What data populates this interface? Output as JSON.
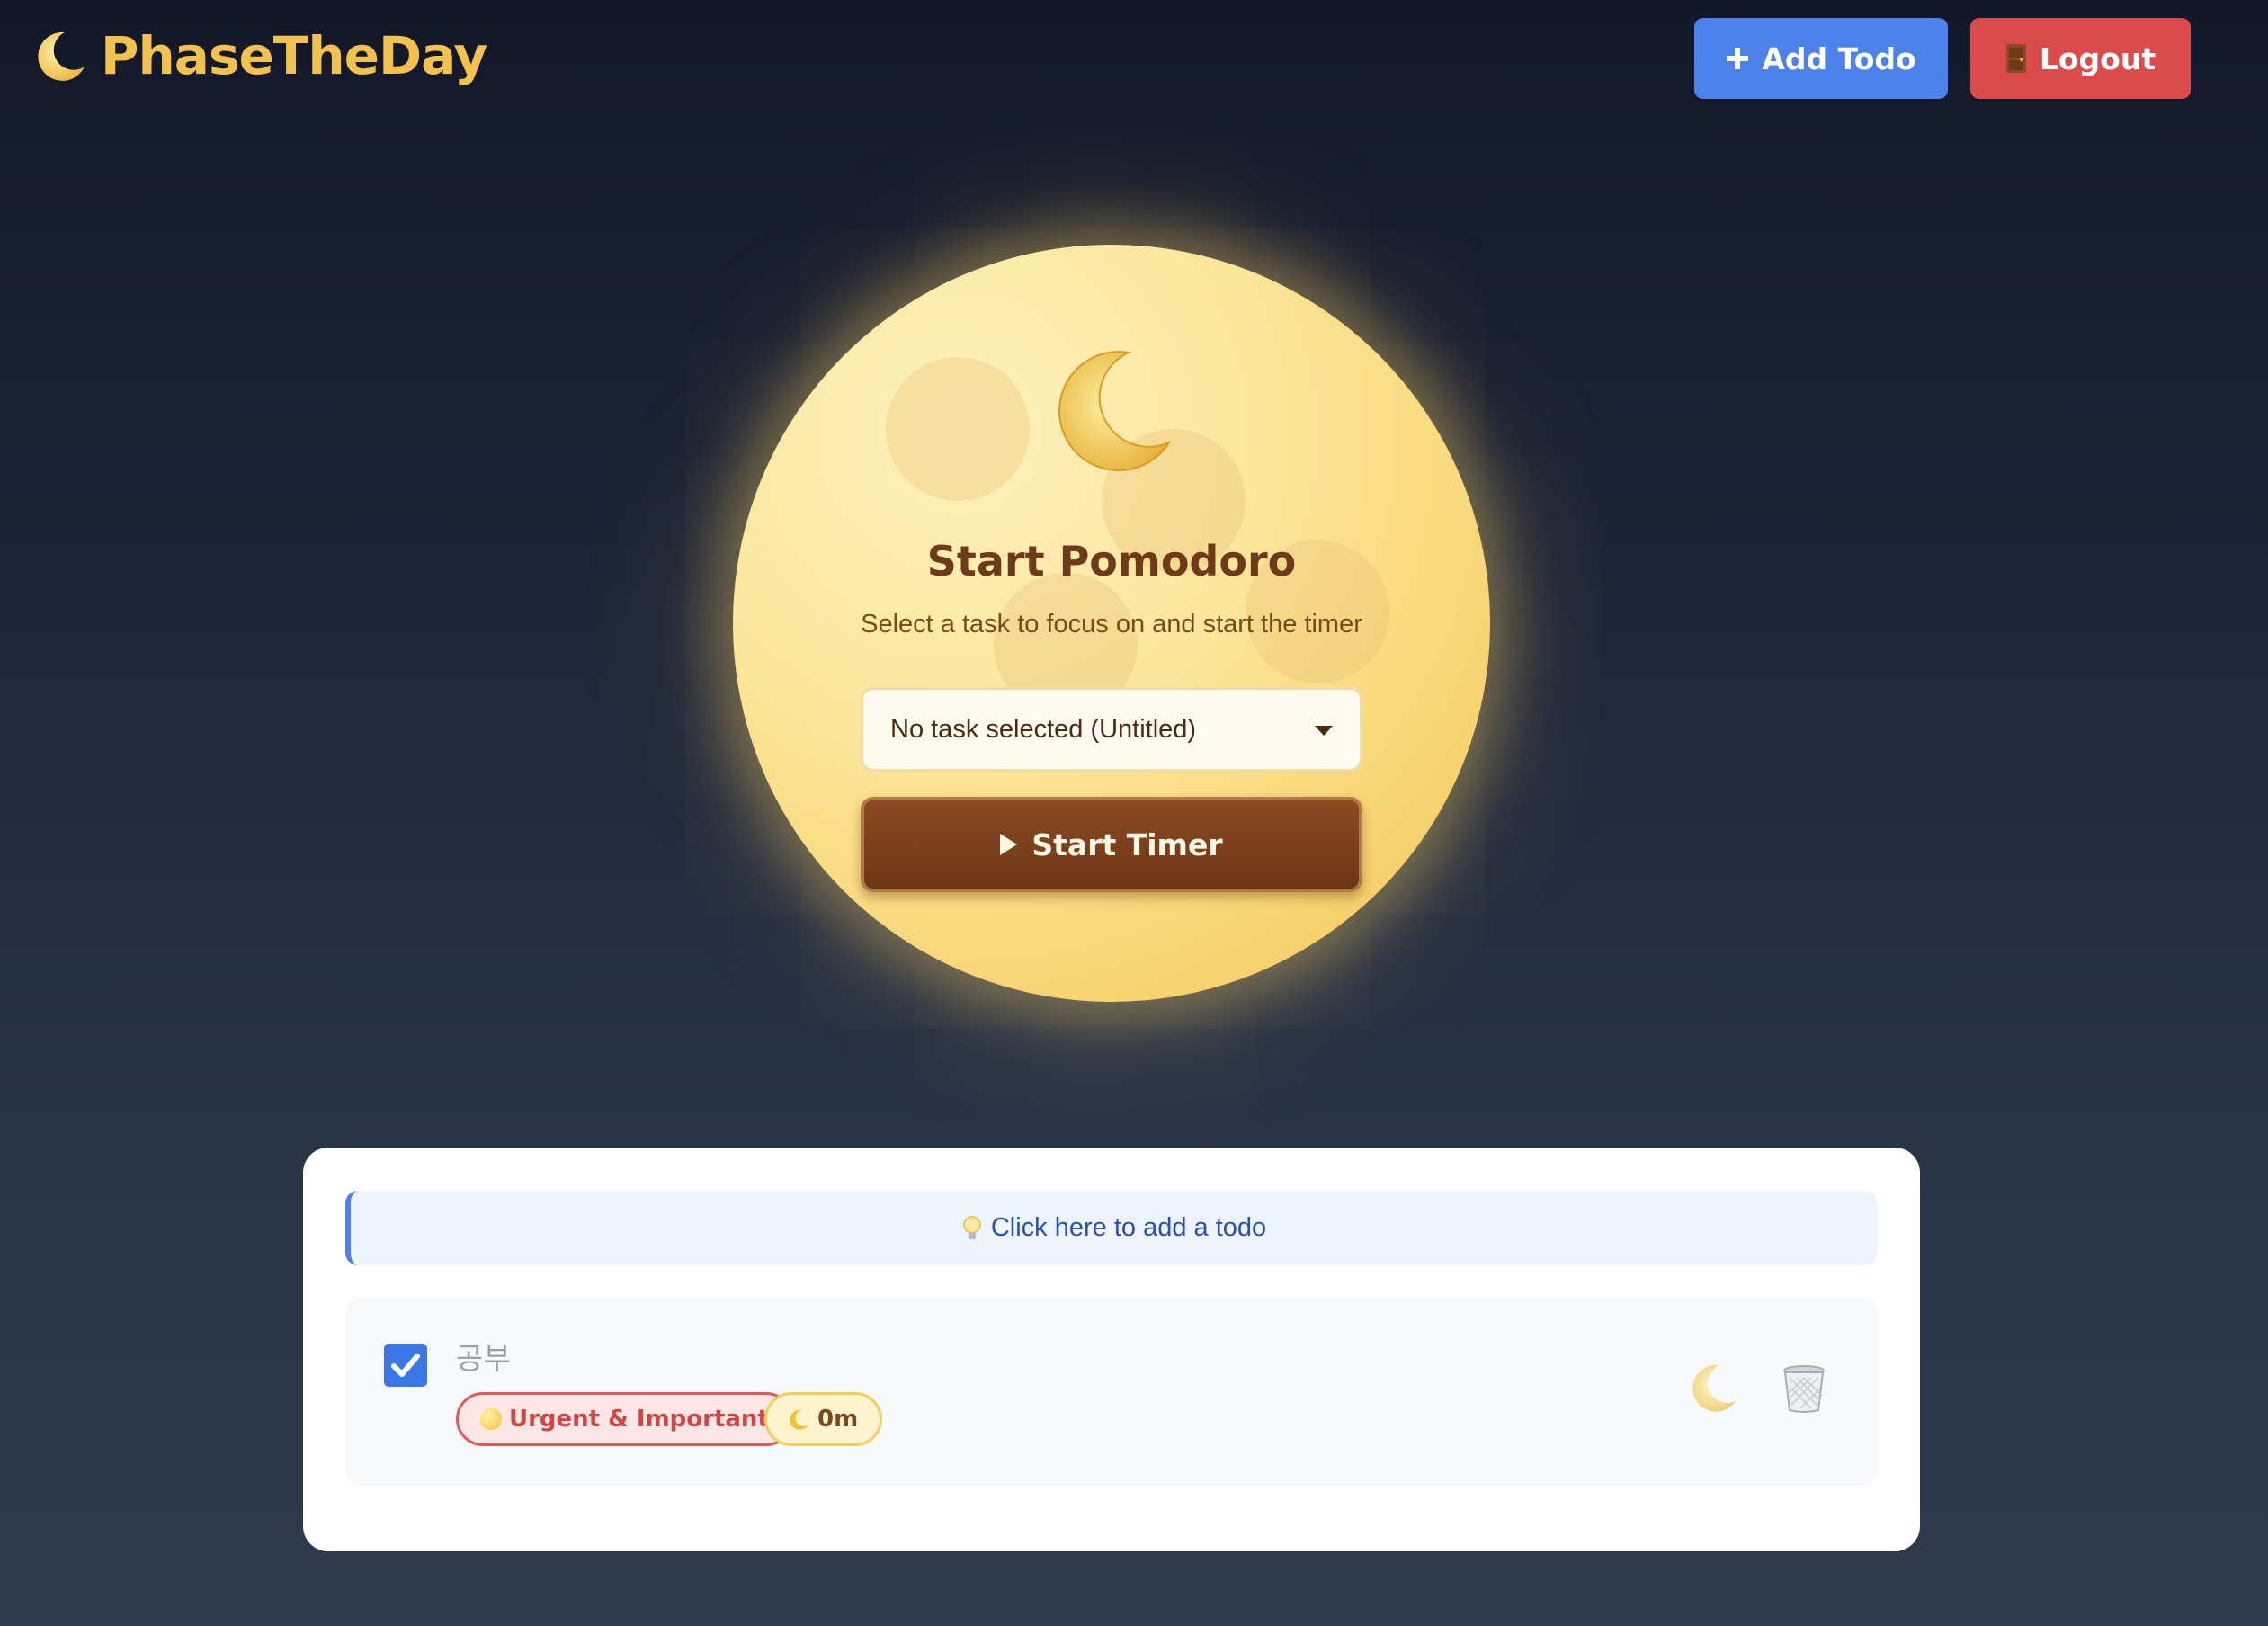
{
  "app": {
    "title": "PhaseTheDay",
    "brand_icon": "crescent-moon-icon"
  },
  "header": {
    "add_todo_label": "Add Todo",
    "add_todo_icon": "plus-icon",
    "logout_label": "Logout",
    "logout_icon": "door-icon"
  },
  "pomodoro": {
    "title": "Start Pomodoro",
    "subtitle": "Select a task to focus on and start the timer",
    "task_select_value": "No task selected (Untitled)",
    "start_button_label": "Start Timer",
    "moon_icon": "crescent-moon-icon"
  },
  "todos": {
    "add_hint_icon": "lightbulb-icon",
    "add_hint_text": "Click here to add a todo",
    "items": [
      {
        "text": "공부",
        "completed": true,
        "priority_label": "Urgent & Important",
        "time_label": "0m",
        "actions": [
          "crescent-moon-icon",
          "trash-icon"
        ]
      }
    ]
  },
  "colors": {
    "brand": "#f2c14e",
    "add_button": "#4c82ea",
    "logout_button": "#dc4b4b",
    "start_button": "#7a3e1a",
    "checkbox": "#3a78e8",
    "priority_tag": "#df5a5a"
  }
}
